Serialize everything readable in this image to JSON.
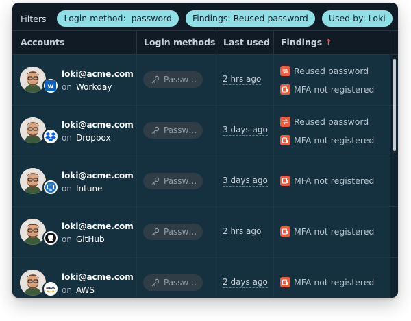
{
  "filters": {
    "label": "Filters",
    "chips": [
      "Login method:  password",
      "Findings: Reused password",
      "Used by: Loki"
    ]
  },
  "table": {
    "columns": [
      "Accounts",
      "Login methods",
      "Last used",
      "Findings"
    ],
    "sort_indicator": "↑",
    "on_label": "on",
    "rows": [
      {
        "email": "loki@acme.com",
        "app": "Workday",
        "app_icon": "workday-icon",
        "login": "Passw…",
        "last_used": "2 hrs ago",
        "findings": [
          "Reused password",
          "MFA not registered"
        ]
      },
      {
        "email": "loki@acme.com",
        "app": "Dropbox",
        "app_icon": "dropbox-icon",
        "login": "Passw…",
        "last_used": "3 days ago",
        "findings": [
          "Reused password",
          "MFA not registered"
        ]
      },
      {
        "email": "loki@acme.com",
        "app": "Intune",
        "app_icon": "intune-icon",
        "login": "Passw…",
        "last_used": "3 days ago",
        "findings": [
          "MFA not registered"
        ]
      },
      {
        "email": "loki@acme.com",
        "app": "GitHub",
        "app_icon": "github-icon",
        "login": "Passw…",
        "last_used": "2 hrs ago",
        "findings": [
          "MFA not registered"
        ]
      },
      {
        "email": "loki@acme.com",
        "app": "AWS",
        "app_icon": "aws-icon",
        "login": "Passw…",
        "last_used": "2 days ago",
        "findings": [
          "MFA not registered"
        ]
      }
    ]
  },
  "colors": {
    "card_bg": "#0f2230",
    "row_bg": "#15303f",
    "chip_bg": "#8fdfe6",
    "finding_icon": "#f05a3c",
    "sort_arrow": "#f0553a"
  }
}
